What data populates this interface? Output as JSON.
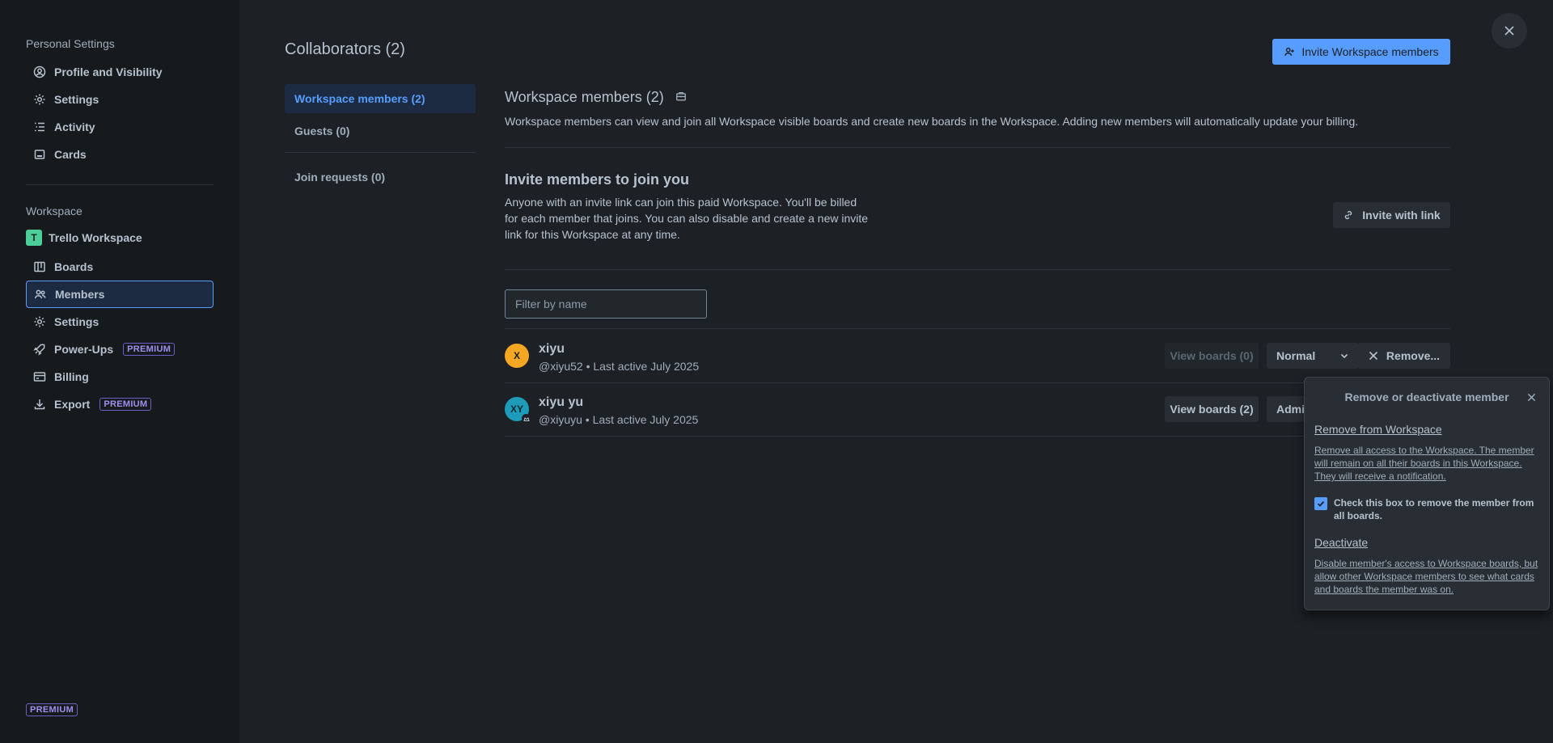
{
  "sidebar": {
    "personal_heading": "Personal Settings",
    "personal_items": [
      {
        "label": "Profile and Visibility",
        "icon": "profile-icon"
      },
      {
        "label": "Settings",
        "icon": "gear-icon"
      },
      {
        "label": "Activity",
        "icon": "activity-icon"
      },
      {
        "label": "Cards",
        "icon": "card-icon"
      }
    ],
    "workspace_heading": "Workspace",
    "workspace_name": "Trello Workspace",
    "workspace_initial": "T",
    "workspace_items": [
      {
        "label": "Boards",
        "icon": "boards-icon"
      },
      {
        "label": "Members",
        "icon": "members-icon"
      },
      {
        "label": "Settings",
        "icon": "gear-icon"
      },
      {
        "label": "Power-Ups",
        "icon": "rocket-icon",
        "badge": "PREMIUM"
      },
      {
        "label": "Billing",
        "icon": "credit-card-icon"
      },
      {
        "label": "Export",
        "icon": "download-icon",
        "badge": "PREMIUM"
      }
    ],
    "bottom_badge": "PREMIUM"
  },
  "main": {
    "title": "Collaborators (2)",
    "invite_ws_button": "Invite Workspace members",
    "tabs": [
      {
        "label": "Workspace members (2)"
      },
      {
        "label": "Guests (0)"
      },
      {
        "label": "Join requests (0)"
      }
    ],
    "section_title": "Workspace members (2)",
    "section_desc": "Workspace members can view and join all Workspace visible boards and create new boards in the Workspace. Adding new members will automatically update your billing.",
    "invite_title": "Invite members to join you",
    "invite_desc": "Anyone with an invite link can join this paid Workspace. You'll be billed for each member that joins. You can also disable and create a new invite link for this Workspace at any time.",
    "invite_link_button": "Invite with link",
    "filter_placeholder": "Filter by name",
    "members": [
      {
        "initials": "X",
        "name": "xiyu",
        "meta": "@xiyu52 • Last active July 2025",
        "view_boards": "View boards (0)",
        "role": "Normal",
        "remove": "Remove...",
        "avatar_color": "#f5a623"
      },
      {
        "initials": "XY",
        "name": "xiyu yu",
        "meta": "@xiyuyu • Last active July 2025",
        "view_boards": "View boards (2)",
        "role": "Admin",
        "avatar_color": "#1d9bb8"
      }
    ]
  },
  "popover": {
    "title": "Remove or deactivate member",
    "remove_link": "Remove from Workspace",
    "remove_desc": "Remove all access to the Workspace. The member will remain on all their boards in this Workspace. They will receive a notification.",
    "checkbox_label": "Check this box to remove the member from all boards.",
    "deactivate_link": "Deactivate",
    "deactivate_desc": "Disable member's access to Workspace boards, but allow other Workspace members to see what cards and boards the member was on."
  },
  "colors": {
    "accent": "#579dff",
    "background": "#1d2125",
    "sidebar": "#161a1d",
    "premium": "#9f8fef"
  }
}
